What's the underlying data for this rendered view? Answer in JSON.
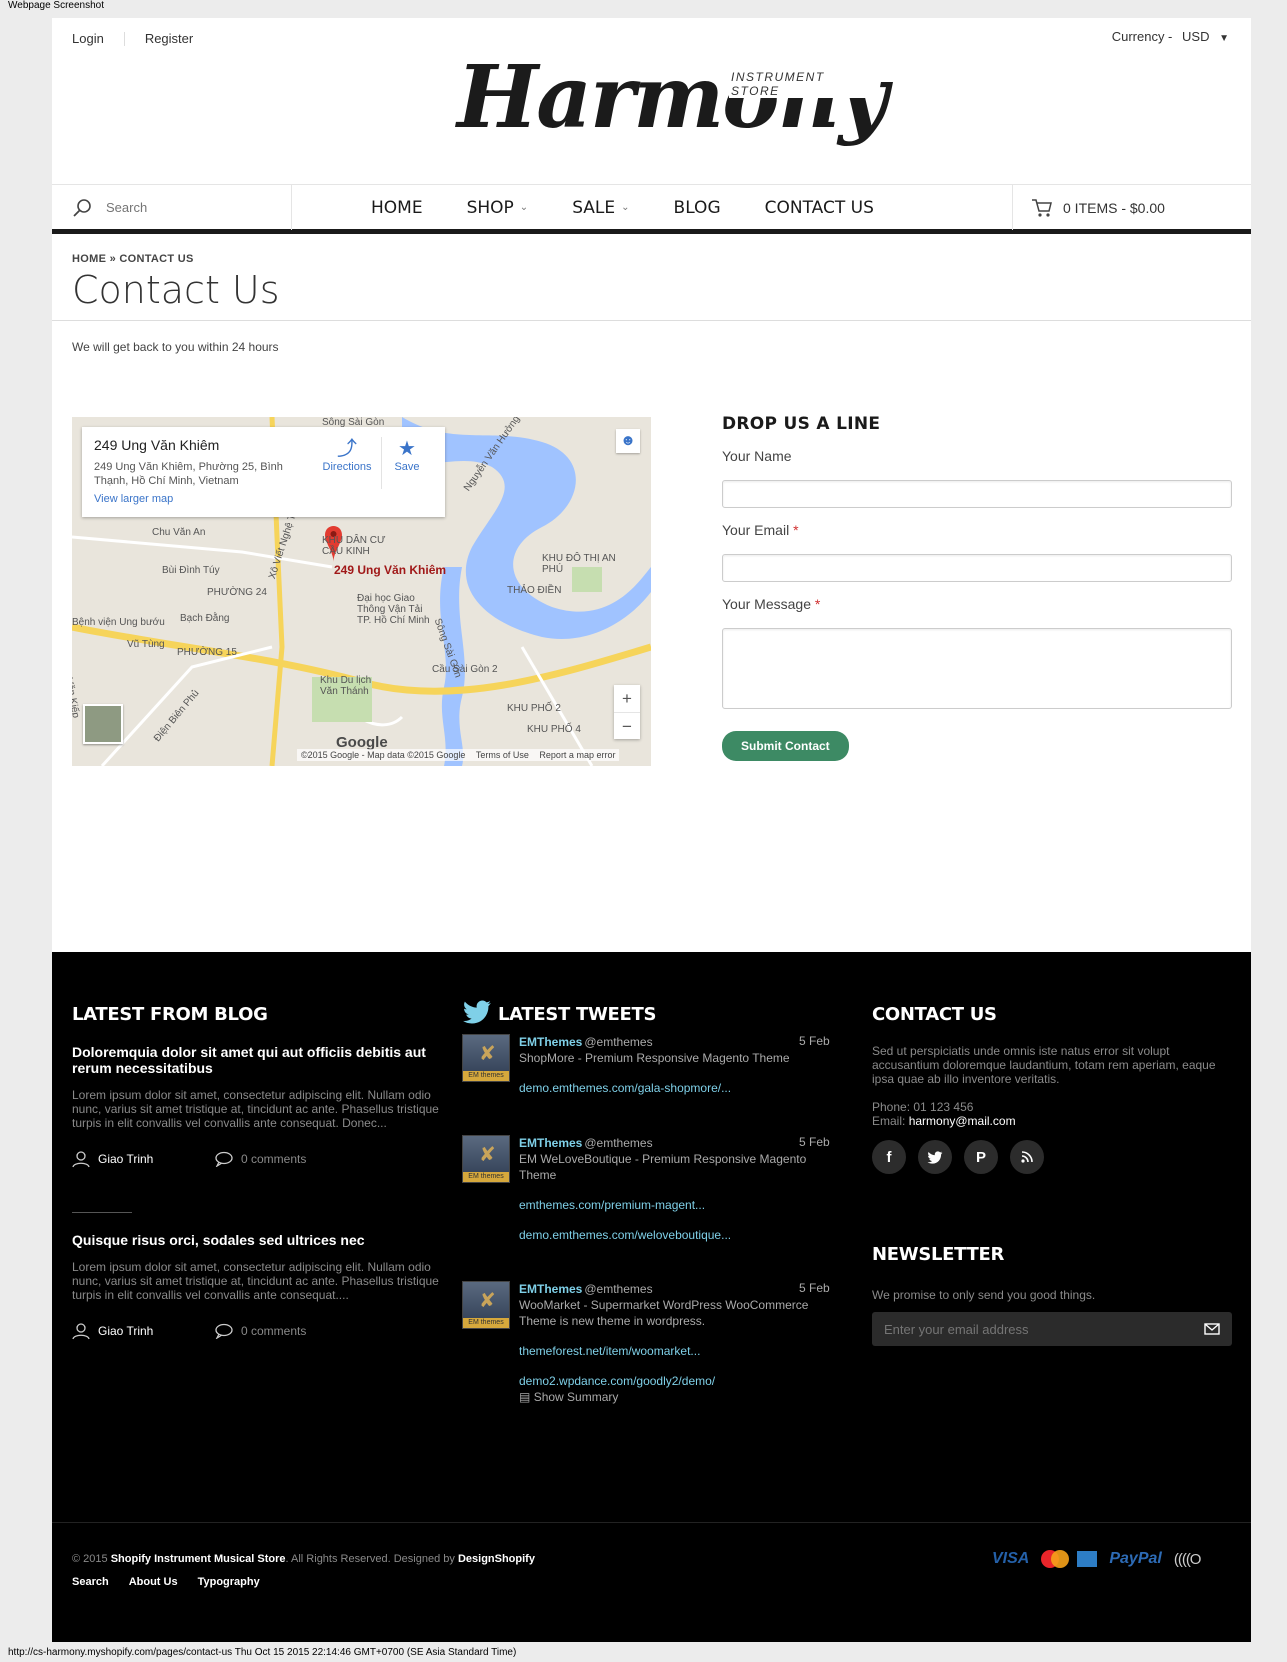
{
  "screenshot": {
    "caption": "Webpage Screenshot",
    "url_footer": "http://cs-harmony.myshopify.com/pages/contact-us Thu Oct 15 2015 22:14:46 GMT+0700 (SE Asia Standard Time)"
  },
  "header": {
    "login": "Login",
    "register": "Register",
    "currency_label": "Currency -",
    "currency_value": "USD",
    "logo_text": "Harmony",
    "logo_sub": "INSTRUMENT STORE"
  },
  "nav": {
    "search_placeholder": "Search",
    "items": [
      {
        "label": "HOME",
        "has_dropdown": false
      },
      {
        "label": "SHOP",
        "has_dropdown": true
      },
      {
        "label": "SALE",
        "has_dropdown": true
      },
      {
        "label": "BLOG",
        "has_dropdown": false
      },
      {
        "label": "CONTACT US",
        "has_dropdown": false
      }
    ],
    "cart": "0 ITEMS - $0.00"
  },
  "breadcrumb": {
    "home": "HOME",
    "separator": "»",
    "current": "CONTACT US"
  },
  "page": {
    "title": "Contact Us",
    "intro": "We will get back to you within 24 hours"
  },
  "map": {
    "place_title": "249 Ung Văn Khiêm",
    "address": "249 Ung Văn Khiêm, Phường 25, Bình Thạnh, Hồ Chí Minh, Vietnam",
    "larger_map": "View larger map",
    "directions": "Directions",
    "save": "Save",
    "pin_label": "249 Ung Văn Khiêm",
    "google": "Google",
    "attribution": "©2015 Google - Map data ©2015 Google",
    "terms": "Terms of Use",
    "report": "Report a map error",
    "labels": [
      "Sông Sài Gòn",
      "Chu Văn An",
      "Bùi Đình Túy",
      "PHƯỜNG 24",
      "Bạch Đằng",
      "PHƯỜNG 15",
      "Vũ Tùng",
      "KHU DÂN CƯ CẦU KINH",
      "THẢO ĐIỀN",
      "KHU ĐÔ THỊ AN PHÚ",
      "Cầu Sài Gòn 2",
      "KHU PHỐ 2",
      "KHU PHỐ 4",
      "Khu Du lịch Văn Thánh",
      "Đại học Giao Thông Vận Tải TP. Hồ Chí Minh",
      "Xô Viết Nghệ Tĩnh",
      "Nguyễn Văn Hưởng",
      "Sông Sài Gòn",
      "Điện Biên Phủ",
      "Bệnh viện Ung bướu",
      "Văn Kiếp"
    ]
  },
  "form": {
    "heading": "DROP US A LINE",
    "name_label": "Your Name",
    "email_label": "Your Email",
    "message_label": "Your Message",
    "required_mark": "*",
    "submit": "Submit Contact"
  },
  "footer": {
    "blog": {
      "title": "LATEST FROM BLOG",
      "posts": [
        {
          "title": "Doloremquia dolor sit amet qui aut officiis debitis aut rerum necessitatibus",
          "excerpt": "Lorem ipsum dolor sit amet, consectetur adipiscing elit. Nullam odio nunc, varius sit amet tristique at, tincidunt ac ante. Phasellus tristique turpis in elit convallis vel convallis ante consequat. Donec...",
          "author": "Giao Trinh",
          "comments": "0 comments"
        },
        {
          "title": "Quisque risus orci, sodales sed ultrices nec",
          "excerpt": "Lorem ipsum dolor sit amet, consectetur adipiscing elit. Nullam odio nunc, varius sit amet tristique at, tincidunt ac ante. Phasellus tristique turpis in elit convallis vel convallis ante consequat....",
          "author": "Giao Trinh",
          "comments": "0 comments"
        }
      ]
    },
    "tweets": {
      "title": "LATEST TWEETS",
      "avatar_badge": "EM themes",
      "items": [
        {
          "name": "EMThemes",
          "handle": "@emthemes",
          "date": "5 Feb",
          "text": "ShopMore - Premium Responsive Magento Theme",
          "links": [
            "demo.emthemes.com/gala-shopmore/..."
          ]
        },
        {
          "name": "EMThemes",
          "handle": "@emthemes",
          "date": "5 Feb",
          "text": "EM WeLoveBoutique - Premium Responsive Magento Theme",
          "links": [
            "emthemes.com/premium-magent...",
            "demo.emthemes.com/weloveboutique..."
          ]
        },
        {
          "name": "EMThemes",
          "handle": "@emthemes",
          "date": "5 Feb",
          "text": "WooMarket - Supermarket WordPress WooCommerce Theme is new theme in wordpress.",
          "links": [
            "themeforest.net/item/woomarket...",
            "demo2.wpdance.com/goodly2/demo/"
          ],
          "summary": "Show Summary"
        }
      ]
    },
    "contact": {
      "title": "CONTACT US",
      "description": "Sed ut perspiciatis unde omnis iste natus error sit volupt accusantium doloremque laudantium, totam rem aperiam, eaque ipsa quae ab illo inventore veritatis.",
      "phone": "Phone: 01 123 456",
      "email_label": "Email:",
      "email": "harmony@mail.com",
      "social": [
        "facebook-icon",
        "twitter-icon",
        "pinterest-icon",
        "rss-icon"
      ]
    },
    "newsletter": {
      "title": "NEWSLETTER",
      "description": "We promise to only send you good things.",
      "placeholder": "Enter your email address"
    },
    "copyright": {
      "prefix": "© 2015",
      "store": "Shopify Instrument Musical Store",
      "middle": ". All Rights Reserved. Designed by",
      "designer": "DesignShopify"
    },
    "links": [
      "Search",
      "About Us",
      "Typography"
    ],
    "payments": {
      "visa": "VISA",
      "paypal": "PayPal",
      "contactless": "((((O"
    }
  },
  "colors": {
    "accent_green": "#3d8a64",
    "link_blue": "#7fd0e8",
    "footer_bg": "#000000"
  }
}
